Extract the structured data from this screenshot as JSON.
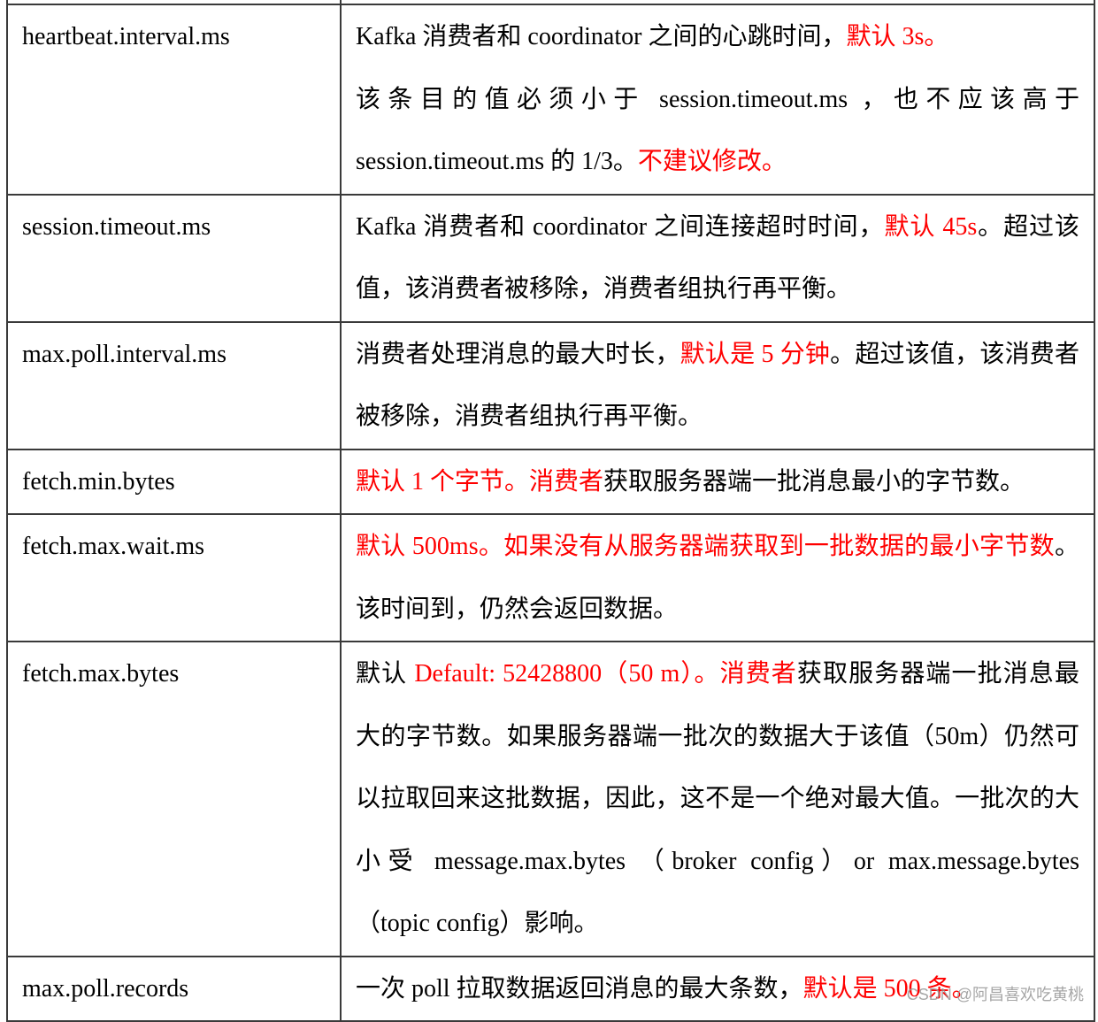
{
  "table": {
    "rows": [
      {
        "key": "heartbeat.interval.ms",
        "segments": [
          {
            "text": "Kafka 消费者和 coordinator 之间的心跳时间，",
            "red": false
          },
          {
            "text": "默认 3s。",
            "red": true
          },
          {
            "text": "该条目的值必须小于 session.timeout.ms ，也不应该高于 session.timeout.ms 的 1/3。",
            "red": false
          },
          {
            "text": "不建议修改。",
            "red": true
          }
        ]
      },
      {
        "key": "session.timeout.ms",
        "segments": [
          {
            "text": "Kafka 消费者和 coordinator 之间连接超时时间，",
            "red": false
          },
          {
            "text": "默认 45s",
            "red": true
          },
          {
            "text": "。超过该值，该消费者被移除，消费者组执行再平衡。",
            "red": false
          }
        ]
      },
      {
        "key": "max.poll.interval.ms",
        "segments": [
          {
            "text": "消费者处理消息的最大时长，",
            "red": false
          },
          {
            "text": "默认是 5 分钟",
            "red": true
          },
          {
            "text": "。超过该值，该消费者被移除，消费者组执行再平衡。",
            "red": false
          }
        ]
      },
      {
        "key": "fetch.min.bytes",
        "segments": [
          {
            "text": "默认 1 个字节。消费者",
            "red": true
          },
          {
            "text": "获取服务器端一批消息最小的字节数。",
            "red": false
          }
        ]
      },
      {
        "key": "fetch.max.wait.ms",
        "segments": [
          {
            "text": "默认 500ms。如果没有从服务器端获取到一批数据的最小字节数",
            "red": true
          },
          {
            "text": "。该时间到，仍然会返回数据。",
            "red": false
          }
        ]
      },
      {
        "key": "fetch.max.bytes",
        "segments": [
          {
            "text": "默认 ",
            "red": false
          },
          {
            "text": "Default: 52428800（50 m）。消费者",
            "red": true
          },
          {
            "text": "获取服务器端一批消息最大的字节数。如果服务器端一批次的数据大于该值（50m）仍然可以拉取回来这批数据，因此，这不是一个绝对最大值。一批次的大小受 message.max.bytes （broker config）or max.message.bytes （topic config）影响。",
            "red": false
          }
        ]
      },
      {
        "key": "max.poll.records",
        "segments": [
          {
            "text": "一次 poll 拉取数据返回消息的最大条数，",
            "red": false
          },
          {
            "text": "默认是 500 条。",
            "red": true
          }
        ]
      }
    ]
  },
  "watermark": "CSDN @阿昌喜欢吃黄桃",
  "colors": {
    "highlight": "#ff0000",
    "text": "#000000",
    "border": "#3a3a3a"
  }
}
